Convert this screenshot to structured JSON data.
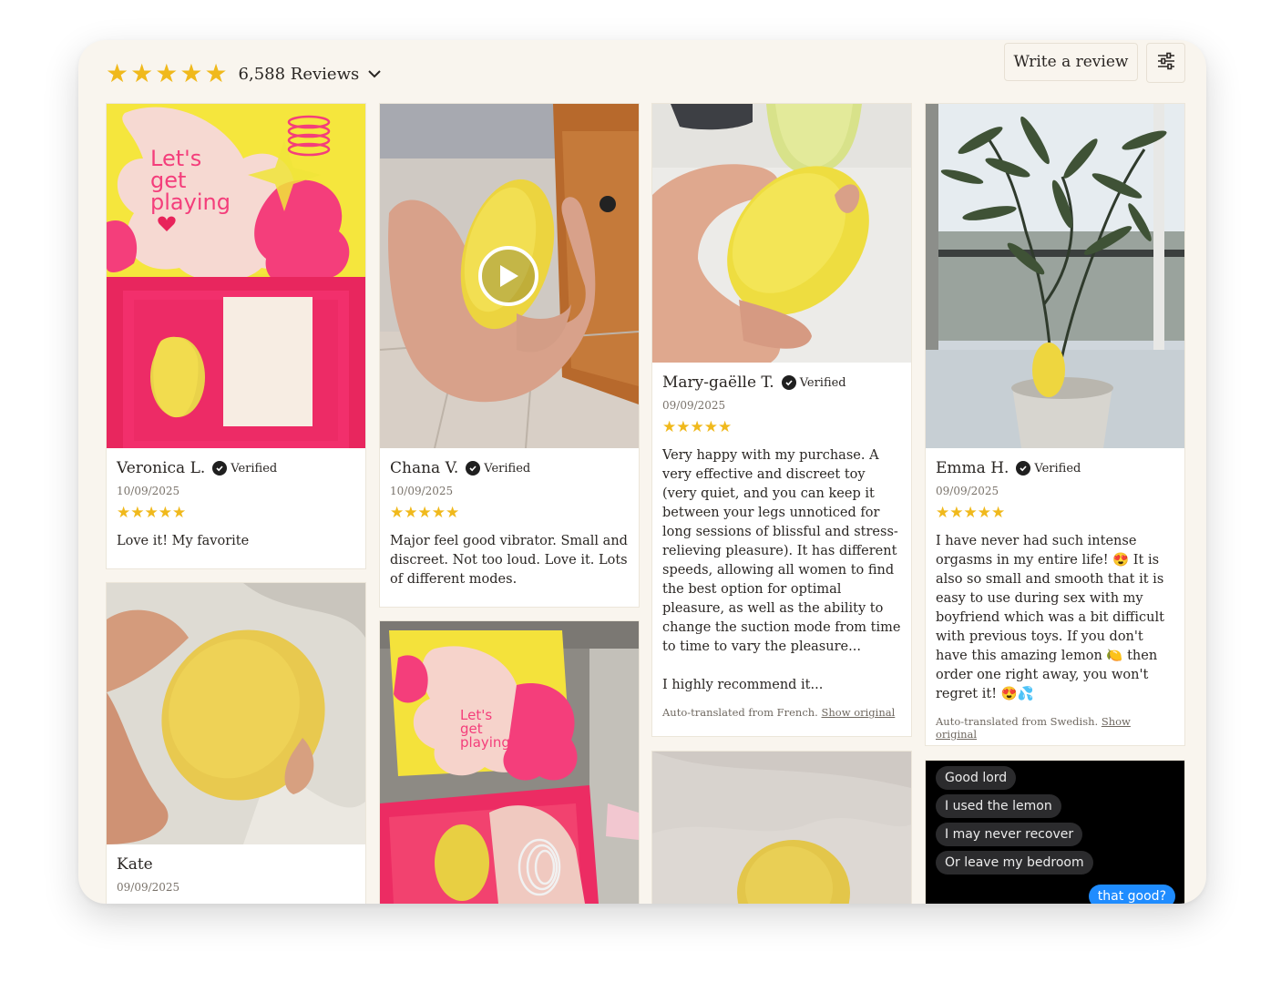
{
  "header": {
    "rating_stars": 5,
    "review_count_label": "6,588 Reviews",
    "write_review_label": "Write a review",
    "filter_icon": "sliders-icon"
  },
  "colors": {
    "star": "#f0b91c",
    "panel_bg": "#f9f5ee",
    "chat_me": "#1f8cff"
  },
  "reviews": [
    {
      "name": "Veronica L.",
      "verified": "Verified",
      "date": "10/09/2025",
      "rating": 5,
      "text": [
        "Love it! My favorite"
      ],
      "photo_text": [
        "Let's",
        "get",
        "playing"
      ]
    },
    {
      "name": "Chana V.",
      "verified": "Verified",
      "date": "10/09/2025",
      "rating": 5,
      "text": [
        "Major feel good  vibrator. Small and discreet. Not too loud. Love it. Lots of different modes."
      ],
      "has_video": true
    },
    {
      "name": "Mary-gaëlle T.",
      "verified": "Verified",
      "date": "09/09/2025",
      "rating": 5,
      "text": [
        "Very happy with my purchase. A very effective and discreet toy (very quiet, and you can keep it between your legs unnoticed for long sessions of blissful and stress-relieving pleasure). It has different speeds, allowing all women to find the best option for optimal pleasure, as well as the ability to change the suction mode from time to time to vary the pleasure...",
        "I highly recommend it..."
      ],
      "translation_note": "Auto-translated from French.",
      "show_original": "Show original"
    },
    {
      "name": "Emma H.",
      "verified": "Verified",
      "date": "09/09/2025",
      "rating": 5,
      "text": [
        "I have never had such intense orgasms in my entire life! 😍 It is also so small and smooth that it is easy to use during sex with my boyfriend which was a bit difficult with previous toys. If you don't have this amazing lemon 🍋 then order one right away, you won't regret it! 😍💦"
      ],
      "translation_note": "Auto-translated from Swedish.",
      "show_original": "Show original"
    },
    {
      "name": "Kate",
      "date": "09/09/2025"
    }
  ],
  "box_photo_text": [
    "Let's",
    "get",
    "playing"
  ],
  "chat_messages": [
    "Good lord",
    "I used the lemon",
    "I may never recover",
    "Or leave my bedroom",
    "that good?"
  ]
}
